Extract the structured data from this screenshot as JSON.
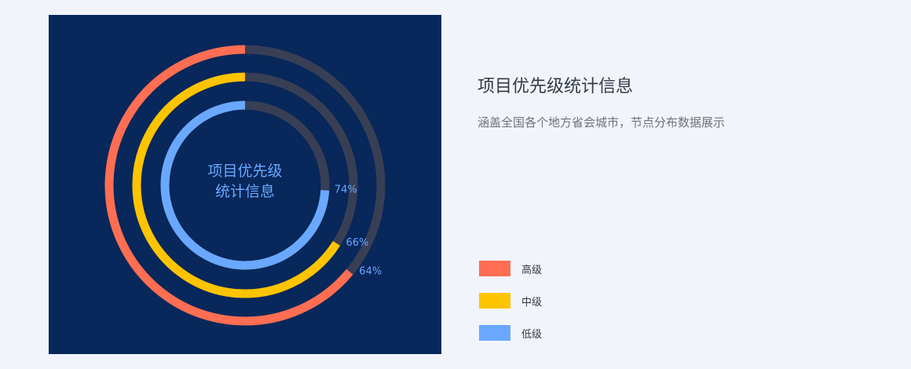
{
  "info": {
    "title": "项目优先级统计信息",
    "description": "涵盖全国各个地方省会城市，节点分布数据展示"
  },
  "chart_data": {
    "type": "donut",
    "center_title_line1": "项目优先级",
    "center_title_line2": "统计信息",
    "series": [
      {
        "name": "高级",
        "value": 64,
        "label": "64%",
        "color": "#ff6e52"
      },
      {
        "name": "中级",
        "value": 66,
        "label": "66%",
        "color": "#ffc400"
      },
      {
        "name": "低级",
        "value": 74,
        "label": "74%",
        "color": "#6aa8ff"
      }
    ],
    "track_color": "#383f55",
    "max": 100
  },
  "legend": [
    {
      "label": "高级",
      "color": "#ff6e52"
    },
    {
      "label": "中级",
      "color": "#ffc400"
    },
    {
      "label": "低级",
      "color": "#6aa8ff"
    }
  ],
  "colors": {
    "panel_bg": "#08275a",
    "page_bg": "#f1f4fb"
  }
}
